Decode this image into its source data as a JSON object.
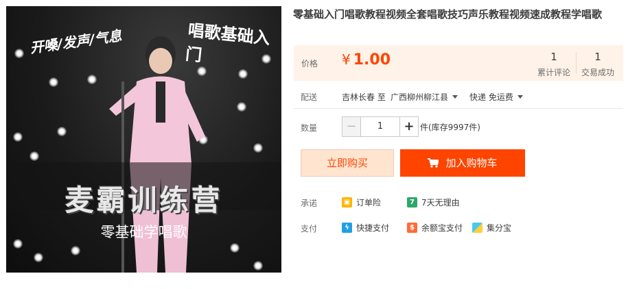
{
  "product": {
    "title": "零基础入门唱歌教程视频全套唱歌技巧声乐教程视频速成教程学唱歌",
    "image_texts": {
      "top_left": "开嗓/发声/气息",
      "top_right": "唱歌基础入门",
      "banner": "麦霸训练营",
      "subtitle": "零基础学唱歌"
    }
  },
  "price": {
    "label": "价格",
    "currency": "¥",
    "value": "1.00",
    "comments_count": "1",
    "comments_label": "累计评论",
    "sales_count": "1",
    "sales_label": "交易成功"
  },
  "delivery": {
    "label": "配送",
    "from": "吉林长春 至",
    "to": "广西柳州柳江县",
    "method": "快递 免运费"
  },
  "quantity": {
    "label": "数量",
    "value": "1",
    "minus": "−",
    "plus": "+",
    "stock_text": "件(库存9997件)"
  },
  "actions": {
    "buy_now": "立即购买",
    "add_to_cart": "加入购物车"
  },
  "promise": {
    "label": "承诺",
    "items": [
      "订单险",
      "7天无理由"
    ],
    "seven_icon_text": "7"
  },
  "payment": {
    "label": "支付",
    "items": [
      "快捷支付",
      "余额宝支付",
      "集分宝"
    ]
  },
  "colors": {
    "accent": "#ff4400",
    "price_bg": "#fff2e8",
    "buy_now_bg": "#ffe4d0"
  }
}
